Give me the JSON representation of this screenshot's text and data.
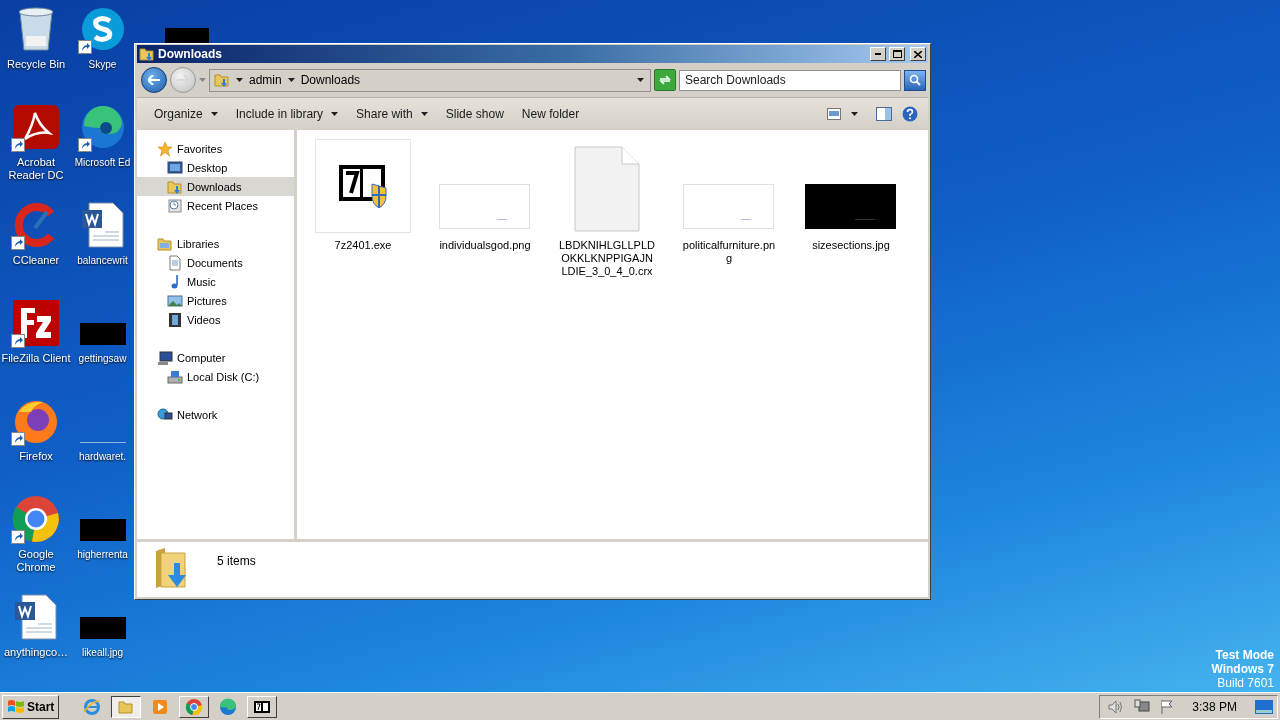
{
  "desktop": {
    "icons": [
      {
        "label": "Recycle Bin",
        "kind": "recycle",
        "shortcut": false
      },
      {
        "label": "Acrobat Reader DC",
        "kind": "acrobat",
        "shortcut": true
      },
      {
        "label": "CCleaner",
        "kind": "ccleaner",
        "shortcut": true
      },
      {
        "label": "FileZilla Client",
        "kind": "filezilla",
        "shortcut": true
      },
      {
        "label": "Firefox",
        "kind": "firefox",
        "shortcut": true
      },
      {
        "label": "Google Chrome",
        "kind": "chrome",
        "shortcut": true
      },
      {
        "label": "anythingco…",
        "kind": "word",
        "shortcut": false
      },
      {
        "label": "Skype",
        "kind": "skype",
        "shortcut": true
      },
      {
        "label": "Microsoft Ed",
        "kind": "edge",
        "shortcut": true
      },
      {
        "label": "balancewrit",
        "kind": "word",
        "shortcut": false
      },
      {
        "label": "gettingsaw",
        "kind": "redacted",
        "shortcut": false
      },
      {
        "label": "hardwaret.",
        "kind": "line",
        "shortcut": false
      },
      {
        "label": "higherrenta",
        "kind": "redacted",
        "shortcut": false
      },
      {
        "label": "likeall.jpg",
        "kind": "redacted",
        "shortcut": false
      }
    ],
    "os_notice": [
      "Test Mode",
      "Windows 7",
      "Build 7601"
    ]
  },
  "window": {
    "title": "Downloads",
    "address": {
      "crumbs": [
        "admin",
        "Downloads"
      ]
    },
    "search": {
      "placeholder": "Search Downloads"
    },
    "commands": [
      {
        "label": "Organize",
        "menu": true
      },
      {
        "label": "Include in library",
        "menu": true
      },
      {
        "label": "Share with",
        "menu": true
      },
      {
        "label": "Slide show",
        "menu": false
      },
      {
        "label": "New folder",
        "menu": false
      }
    ],
    "nav": [
      {
        "label": "Favorites",
        "kind": "star",
        "selected": false,
        "children": [
          {
            "label": "Desktop",
            "kind": "desktop",
            "selected": false
          },
          {
            "label": "Downloads",
            "kind": "downloads",
            "selected": true
          },
          {
            "label": "Recent Places",
            "kind": "recent",
            "selected": false
          }
        ]
      },
      {
        "label": "Libraries",
        "kind": "library",
        "selected": false,
        "children": [
          {
            "label": "Documents",
            "kind": "documents",
            "selected": false
          },
          {
            "label": "Music",
            "kind": "music",
            "selected": false
          },
          {
            "label": "Pictures",
            "kind": "pictures",
            "selected": false
          },
          {
            "label": "Videos",
            "kind": "videos",
            "selected": false
          }
        ]
      },
      {
        "label": "Computer",
        "kind": "computer",
        "selected": false,
        "children": [
          {
            "label": "Local Disk (C:)",
            "kind": "disk",
            "selected": false
          }
        ]
      },
      {
        "label": "Network",
        "kind": "network",
        "selected": false
      }
    ],
    "files": [
      {
        "name": "7z2401.exe",
        "kind": "installer"
      },
      {
        "name": "individualsgod.png",
        "kind": "light-image"
      },
      {
        "name": "LBDKNIHLGLLPLDOKKLKNPPIGAJNLDIE_3_0_4_0.crx",
        "kind": "blank-file"
      },
      {
        "name": "politicalfurniture.png",
        "kind": "light-image"
      },
      {
        "name": "sizesections.jpg",
        "kind": "dark-image"
      }
    ],
    "status": "5 items"
  },
  "taskbar": {
    "start": "Start",
    "apps": [
      {
        "kind": "ie",
        "active": false
      },
      {
        "kind": "explorer",
        "active": true
      },
      {
        "kind": "media",
        "active": false
      },
      {
        "kind": "chrome",
        "active": false
      },
      {
        "kind": "edge",
        "active": false
      },
      {
        "kind": "sevenzip",
        "active": false
      }
    ],
    "clock": "3:38 PM"
  }
}
